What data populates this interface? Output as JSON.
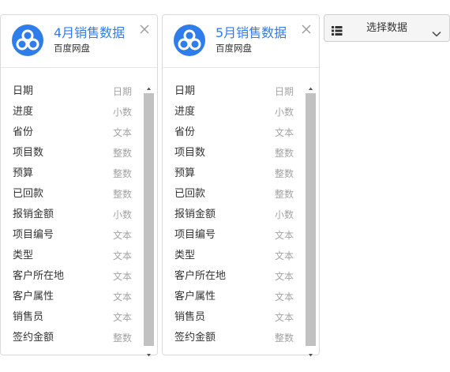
{
  "cards": [
    {
      "title": "4月销售数据",
      "subtitle": "百度网盘",
      "fields": [
        {
          "name": "日期",
          "type": "日期"
        },
        {
          "name": "进度",
          "type": "小数"
        },
        {
          "name": "省份",
          "type": "文本"
        },
        {
          "name": "项目数",
          "type": "整数"
        },
        {
          "name": "预算",
          "type": "整数"
        },
        {
          "name": "已回款",
          "type": "整数"
        },
        {
          "name": "报销金额",
          "type": "小数"
        },
        {
          "name": "项目编号",
          "type": "文本"
        },
        {
          "name": "类型",
          "type": "文本"
        },
        {
          "name": "客户所在地",
          "type": "文本"
        },
        {
          "name": "客户属性",
          "type": "文本"
        },
        {
          "name": "销售员",
          "type": "文本"
        },
        {
          "name": "签约金额",
          "type": "整数"
        }
      ]
    },
    {
      "title": "5月销售数据",
      "subtitle": "百度网盘",
      "fields": [
        {
          "name": "日期",
          "type": "日期"
        },
        {
          "name": "进度",
          "type": "小数"
        },
        {
          "name": "省份",
          "type": "文本"
        },
        {
          "name": "项目数",
          "type": "整数"
        },
        {
          "name": "预算",
          "type": "整数"
        },
        {
          "name": "已回款",
          "type": "整数"
        },
        {
          "name": "报销金额",
          "type": "小数"
        },
        {
          "name": "项目编号",
          "type": "文本"
        },
        {
          "name": "类型",
          "type": "文本"
        },
        {
          "name": "客户所在地",
          "type": "文本"
        },
        {
          "name": "客户属性",
          "type": "文本"
        },
        {
          "name": "销售员",
          "type": "文本"
        },
        {
          "name": "签约金额",
          "type": "整数"
        }
      ]
    }
  ],
  "select": {
    "label": "选择数据",
    "icon": "list-icon"
  },
  "icons": {
    "logo": "baidu-netdisk-logo-icon",
    "close": "close-icon",
    "scroll_up": "scroll-up-arrow-icon",
    "scroll_down": "scroll-down-arrow-icon",
    "dropdown": "chevron-down-icon"
  },
  "colors": {
    "accent": "#2f7dea",
    "type_text": "#a3a3a3",
    "scroll_thumb": "#c1c1c1"
  }
}
